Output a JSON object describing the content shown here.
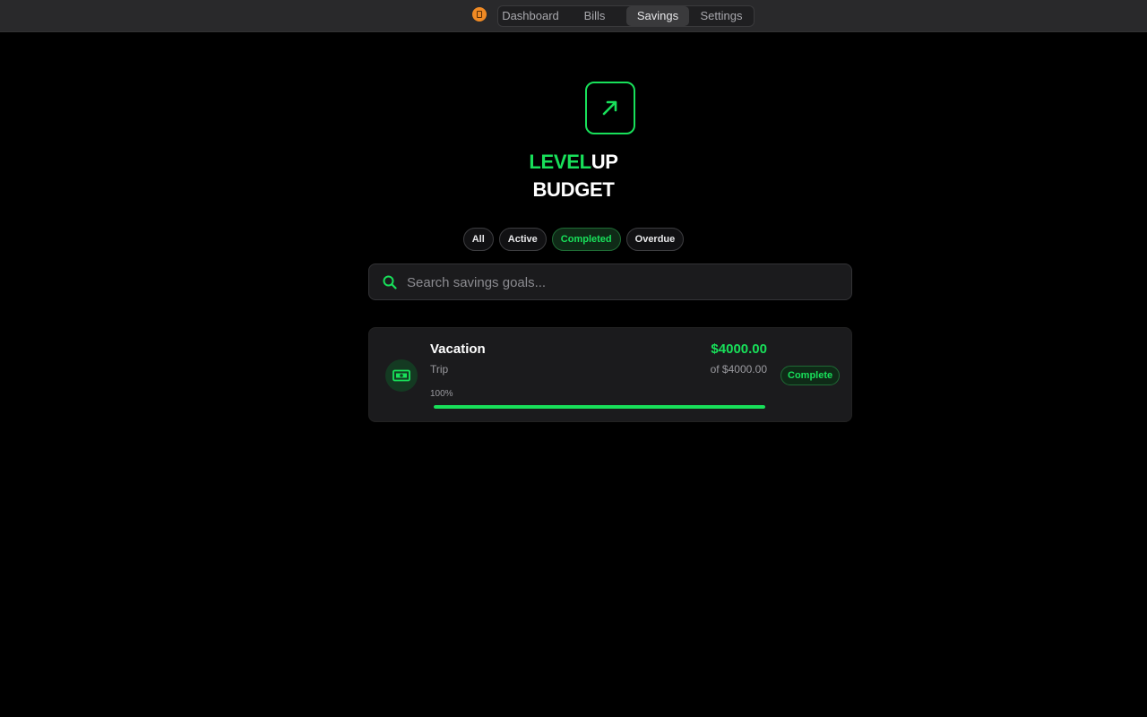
{
  "topbar": {
    "app_icon": "trash-can-icon",
    "tabs": [
      {
        "label": "Dashboard",
        "active": false
      },
      {
        "label": "Bills",
        "active": false
      },
      {
        "label": "Savings",
        "active": true
      },
      {
        "label": "Settings",
        "active": false
      }
    ]
  },
  "brand": {
    "logo_icon": "arrow-up-right-icon",
    "line1_accent": "LEVEL",
    "line1_rest": "UP",
    "line2": "BUDGET",
    "accent_color": "#18e05a"
  },
  "filters": [
    {
      "label": "All",
      "active": false
    },
    {
      "label": "Active",
      "active": false
    },
    {
      "label": "Completed",
      "active": true
    },
    {
      "label": "Overdue",
      "active": false
    }
  ],
  "search": {
    "icon": "search-icon",
    "placeholder": "Search savings goals...",
    "value": ""
  },
  "goals": [
    {
      "icon": "money-bill-icon",
      "name": "Vacation",
      "category": "Trip",
      "saved": "$4000.00",
      "target": "of $4000.00",
      "percent_label": "100%",
      "progress": 1.0,
      "status": "Complete"
    }
  ]
}
